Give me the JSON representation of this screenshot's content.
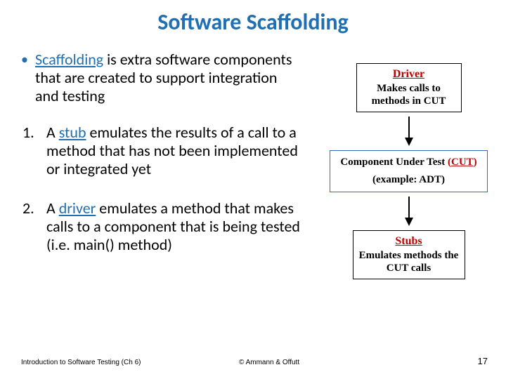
{
  "title": "Software Scaffolding",
  "bullets": {
    "intro": {
      "accent": "Scaffolding",
      "rest": " is extra software components that are created to support integration and testing"
    },
    "item1": {
      "num": "1.",
      "pre": "A ",
      "accent": "stub",
      "post": " emulates the results of a call to a method that has not been implemented or integrated yet"
    },
    "item2": {
      "num": "2.",
      "pre": " A ",
      "accent": "driver",
      "post": " emulates a method that makes calls to a component that is being tested (i.e. main() method)"
    }
  },
  "diagram": {
    "driver": {
      "title": "Driver",
      "sub": "Makes calls to methods in CUT"
    },
    "cut": {
      "line1_a": "Component Under Test ",
      "line1_paren_open": "(",
      "line1_cut": "CUT",
      "line1_paren_close": ")",
      "line2": "(example: ADT)"
    },
    "stubs": {
      "title": "Stubs",
      "sub": "Emulates methods the CUT calls"
    }
  },
  "footer": {
    "left": "Introduction to Software Testing (Ch 6)",
    "mid": "© Ammann & Offutt",
    "right": "17"
  }
}
